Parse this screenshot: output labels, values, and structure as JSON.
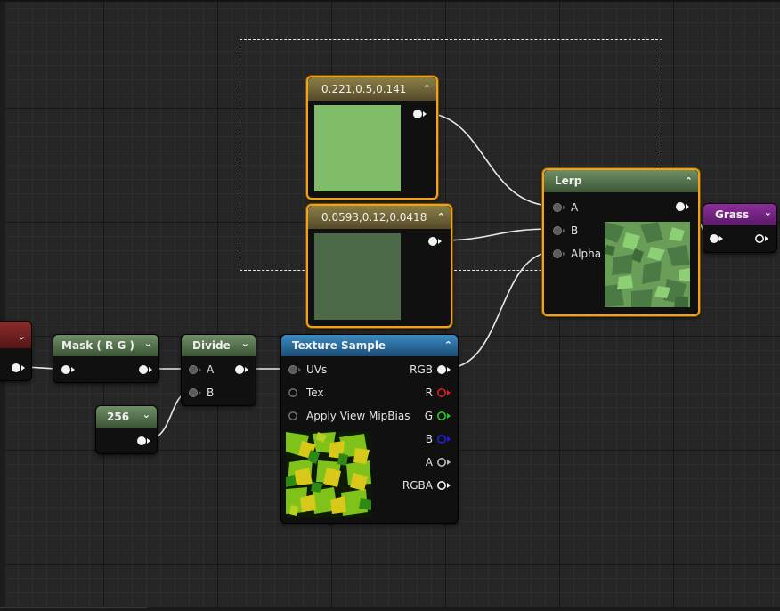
{
  "colors": {
    "color_a": "#7fbd6a",
    "color_b": "#4c6a48",
    "r_pin": "#e02020",
    "g_pin": "#20d020",
    "b_pin": "#2020e0",
    "selection": "#f0a21a"
  },
  "nodes": {
    "const_a": {
      "title": "0.221,0.5,0.141",
      "icon": "chevron-up-icon"
    },
    "const_b": {
      "title": "0.0593,0.12,0.0418",
      "icon": "chevron-up-icon"
    },
    "lerp": {
      "title": "Lerp",
      "inputs": [
        "A",
        "B",
        "Alpha"
      ],
      "icon": "chevron-up-icon"
    },
    "grass": {
      "title": "Grass",
      "icon": "chevron-down-icon"
    },
    "mask": {
      "title": "Mask ( R G )",
      "icon": "chevron-down-icon"
    },
    "divide": {
      "title": "Divide",
      "inputs": [
        "A",
        "B"
      ],
      "icon": "chevron-down-icon"
    },
    "const256": {
      "title": "256",
      "icon": "chevron-down-icon"
    },
    "texture": {
      "title": "Texture Sample",
      "inputs": [
        "UVs",
        "Tex",
        "Apply View MipBias"
      ],
      "outputs": [
        "RGB",
        "R",
        "G",
        "B",
        "A",
        "RGBA"
      ],
      "icon": "chevron-up-icon"
    },
    "left_partial": {
      "icon": "chevron-down-icon"
    }
  }
}
